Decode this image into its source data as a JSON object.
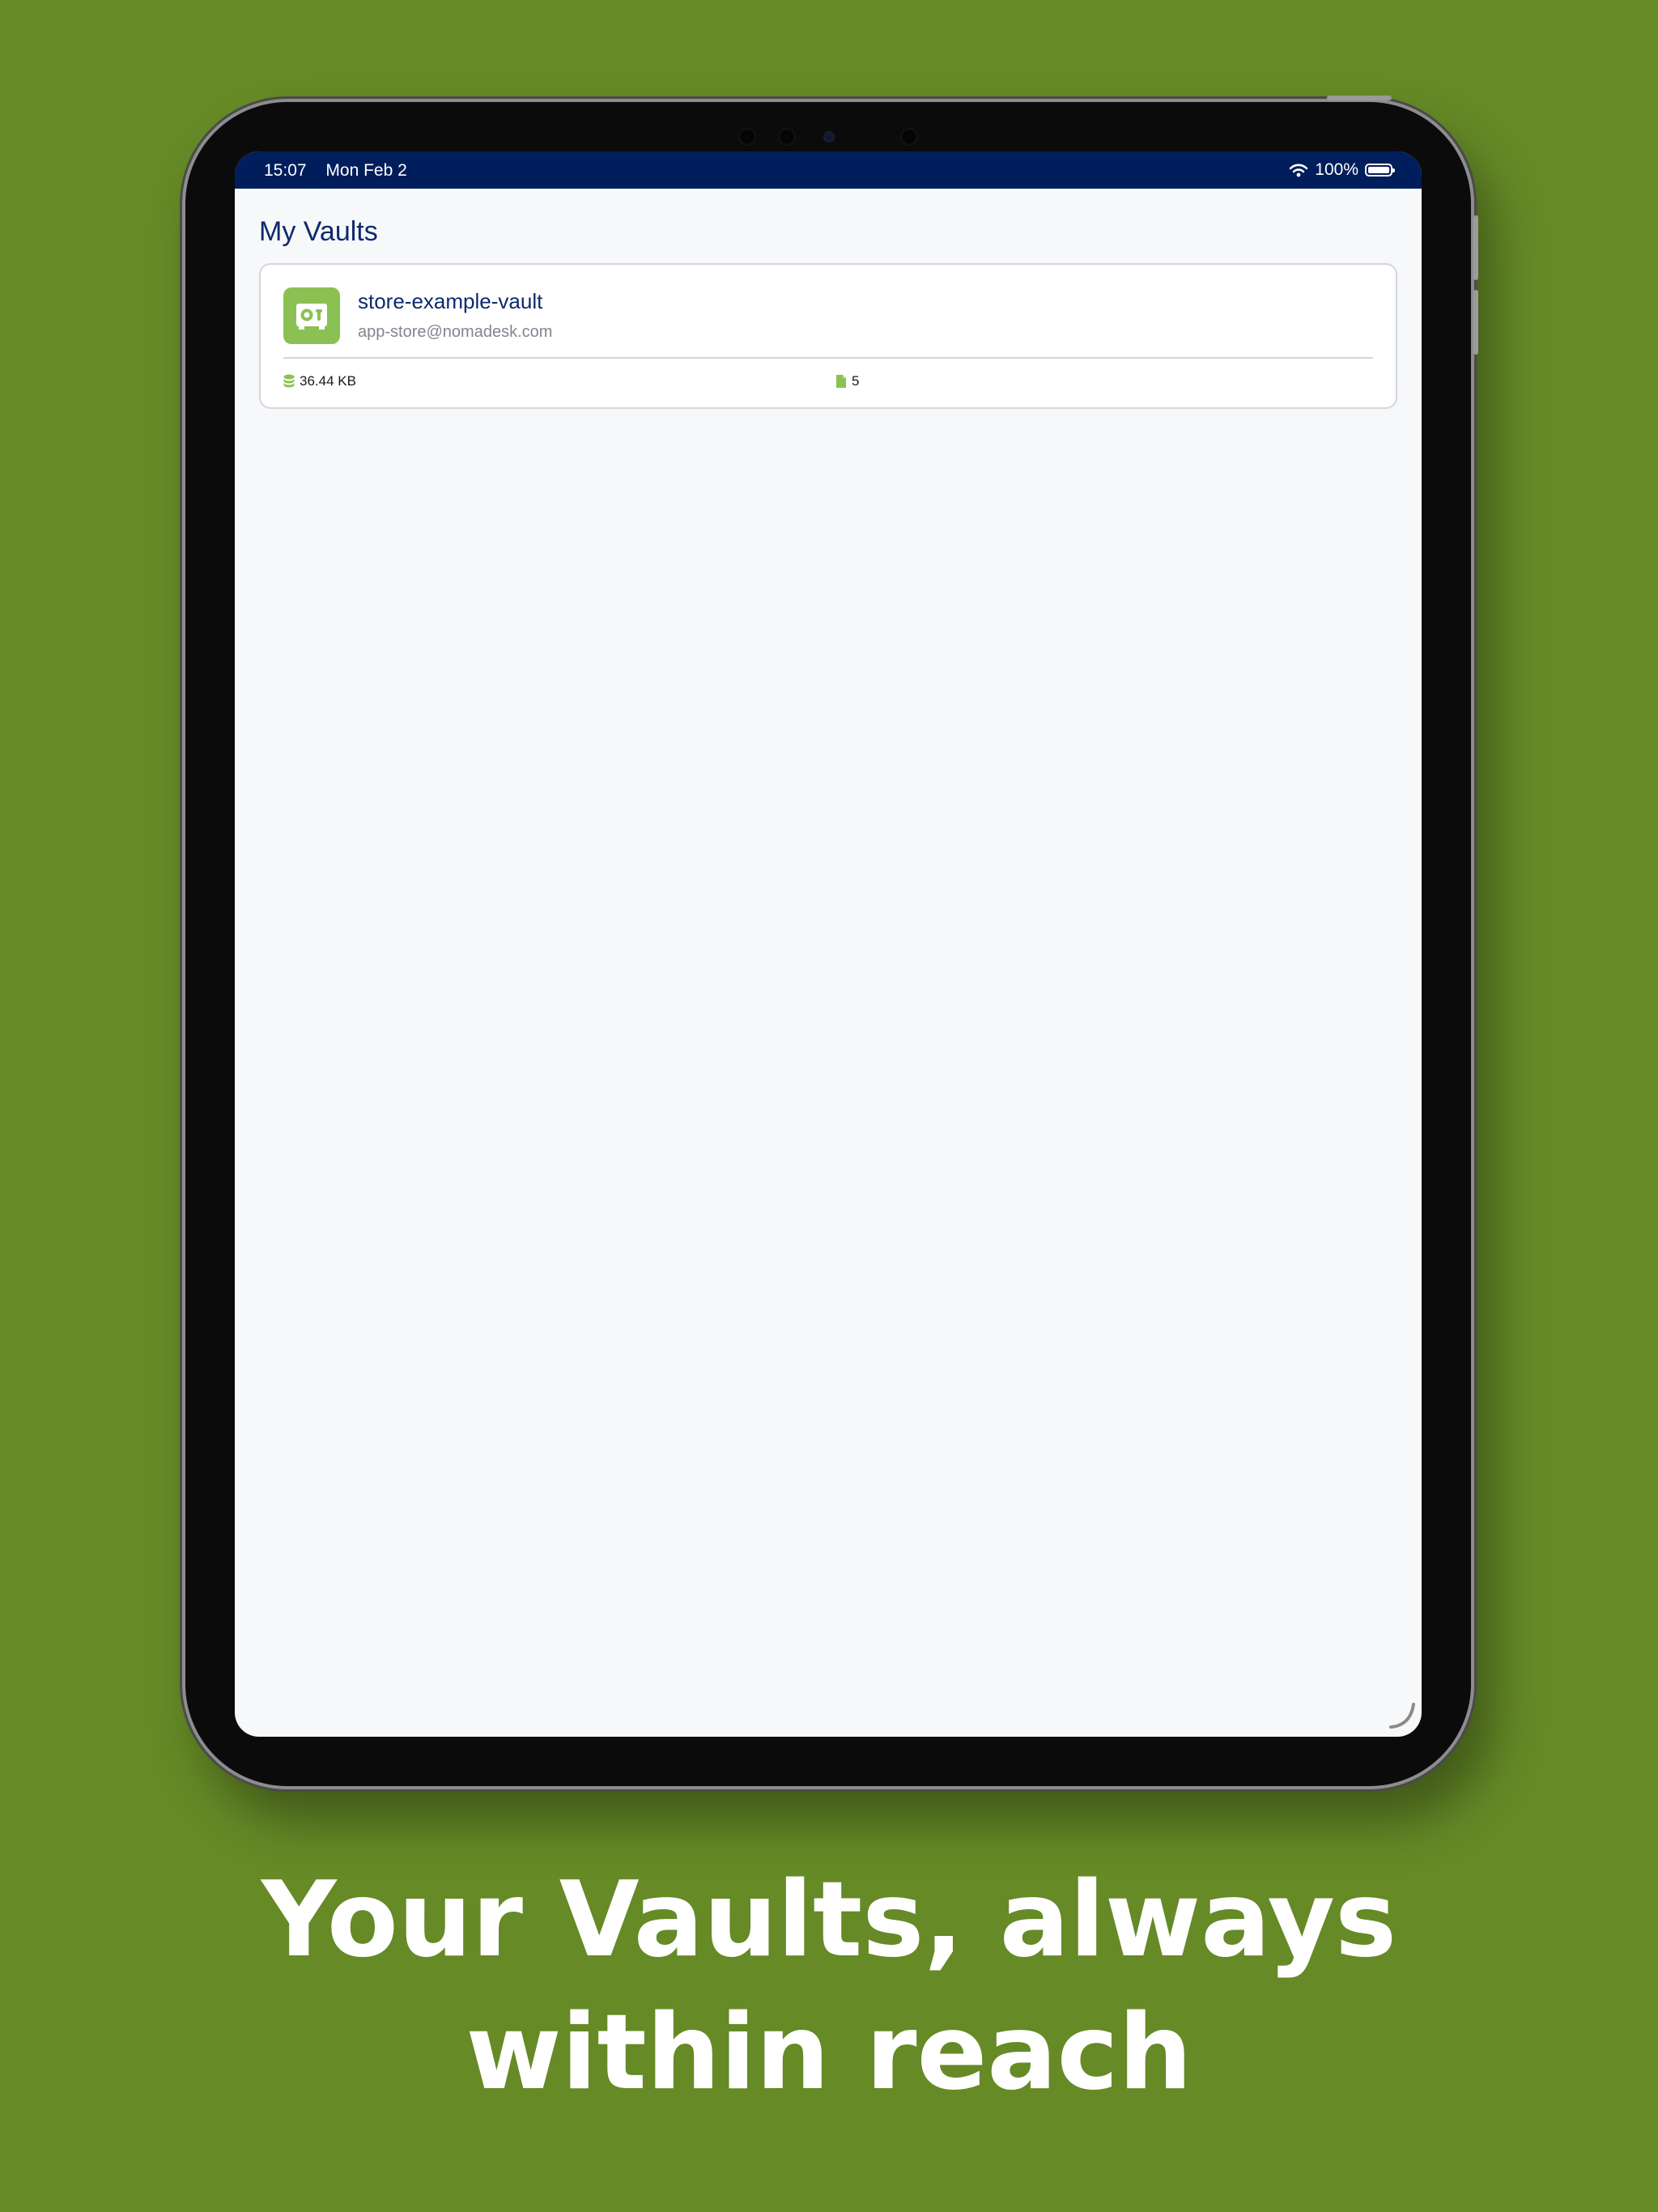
{
  "status_bar": {
    "time": "15:07",
    "date": "Mon Feb 2",
    "battery": "100%"
  },
  "page": {
    "title": "My Vaults"
  },
  "vaults": [
    {
      "name": "store-example-vault",
      "email": "app-store@nomadesk.com",
      "size": "36.44 KB",
      "file_count": "5"
    }
  ],
  "marketing": {
    "headline_line1": "Your Vaults, always",
    "headline_line2": "within reach"
  },
  "colors": {
    "background": "#658a26",
    "status_bar": "#001d5c",
    "accent": "#8bc152",
    "title": "#0d2a6b"
  },
  "icons": [
    "wifi-icon",
    "battery-icon",
    "vault-safe-icon",
    "database-icon",
    "file-icon",
    "resize-grip-icon"
  ]
}
